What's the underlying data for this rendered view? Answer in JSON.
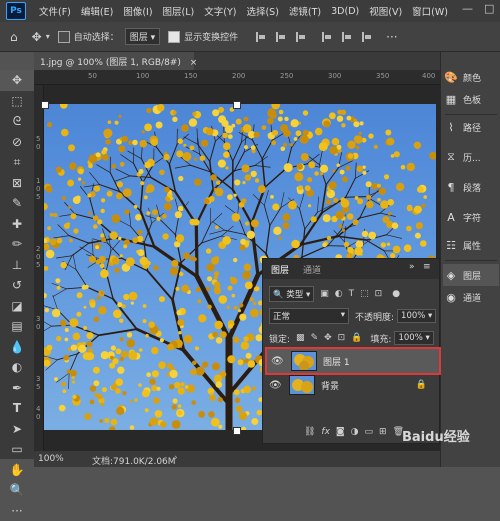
{
  "menubar": {
    "logo": "Ps",
    "items": [
      "文件(F)",
      "编辑(E)",
      "图像(I)",
      "图层(L)",
      "文字(Y)",
      "选择(S)",
      "滤镜(T)",
      "3D(D)",
      "视图(V)",
      "窗口(W)"
    ],
    "minimize": "—",
    "maximize": "□"
  },
  "options": {
    "auto_select_label": "自动选择：",
    "auto_select_target": "图层",
    "show_transform_label": "显示变换控件"
  },
  "document": {
    "tab_title": "1.jpg @ 100% (图层 1, RGB/8#)",
    "tab_close": "×",
    "zoom": "100%",
    "doc_info": "文档:791.0K/2.06M",
    "ruler_top": [
      "50",
      "100",
      "150",
      "200",
      "250",
      "300",
      "350",
      "400"
    ],
    "ruler_left": [
      "5",
      "0",
      "5",
      "1",
      "0",
      "5",
      "2",
      "0",
      "5",
      "3",
      "0",
      "3",
      "5",
      "4",
      "0",
      "4",
      "5"
    ]
  },
  "right_panels": {
    "top_group": [
      {
        "icon": "palette-icon",
        "label": "颜色"
      },
      {
        "icon": "swatches-icon",
        "label": "色板"
      }
    ],
    "mid_group": [
      {
        "icon": "paths-icon",
        "label": "路径"
      },
      {
        "icon": "history-icon",
        "label": "历..."
      },
      {
        "icon": "paragraph-icon",
        "label": "段落"
      },
      {
        "icon": "character-icon",
        "label": "字符"
      },
      {
        "icon": "properties-icon",
        "label": "属性"
      }
    ],
    "bottom_group": [
      {
        "icon": "layers-icon",
        "label": "图层"
      },
      {
        "icon": "channels-icon",
        "label": "通道"
      }
    ]
  },
  "layers_panel": {
    "tab_layers": "图层",
    "tab_channels": "通道",
    "expand": "»",
    "filter_kind": "类型",
    "blend_mode": "正常",
    "opacity_label": "不透明度:",
    "opacity_value": "100%",
    "lock_label": "锁定:",
    "fill_label": "填充:",
    "fill_value": "100%",
    "layers": [
      {
        "name": "图层 1",
        "selected": true,
        "locked": false
      },
      {
        "name": "背景",
        "selected": false,
        "locked": true
      }
    ],
    "bottom_icons": [
      "link-icon",
      "fx-icon",
      "mask-icon",
      "adjustment-icon",
      "group-icon",
      "new-layer-icon",
      "trash-icon"
    ],
    "fx_label": "fx"
  },
  "watermark": "Baidu经验"
}
